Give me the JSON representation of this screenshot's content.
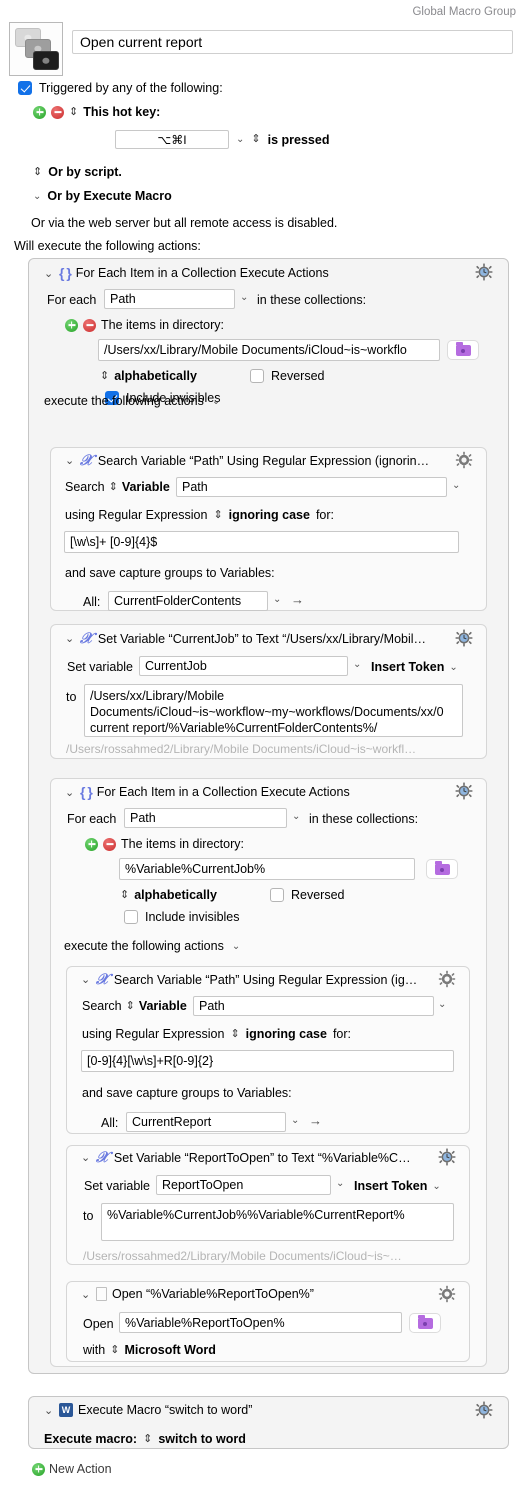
{
  "window": {
    "group_label": "Global Macro Group",
    "macro_name": "Open current report",
    "macro_icon": "stacked-keys-icon"
  },
  "trigger": {
    "checkbox_label": "Triggered by any of the following:",
    "checked": true,
    "hotkey_label": "This hot key:",
    "hotkey_value": "⌥⌘I",
    "hotkey_condition": "is pressed",
    "or_by_script": "Or by script.",
    "or_by_execute_macro": "Or by Execute Macro",
    "web_server_note": "Or via the web server but all remote access is disabled."
  },
  "actions_heading": "Will execute the following actions:",
  "new_action_label": "New Action",
  "actions": {
    "foreach_outer": {
      "title": "For Each Item in a Collection Execute Actions",
      "icon": "braces-icon",
      "gear": "gear-clock-icon",
      "for_each_label": "For each",
      "for_each_value": "Path",
      "in_collections_label": "in these collections:",
      "items_in_directory_label": "The items in directory:",
      "directory_value": "/Users/xx/Library/Mobile Documents/iCloud~is~workflo",
      "sort_value": "alphabetically",
      "reversed_label": "Reversed",
      "reversed_checked": false,
      "include_invisibles_label": "Include invisibles",
      "include_invisibles_checked": true,
      "execute_following_label": "execute the following actions"
    },
    "search1": {
      "title": "Search Variable “Path” Using Regular Expression (ignorin…",
      "icon": "variable-x-icon",
      "gear": "gear-icon",
      "search_label": "Search",
      "source_type": "Variable",
      "source_value": "Path",
      "using_label": "using Regular Expression",
      "case_option": "ignoring case",
      "for_label": "for:",
      "regex_value": "[\\w\\s]+ [0-9]{4}$",
      "capture_label": "and save capture groups to Variables:",
      "all_label": "All:",
      "all_value": "CurrentFolderContents"
    },
    "setvar1": {
      "title": "Set Variable “CurrentJob” to Text “/Users/xx/Library/Mobil…",
      "icon": "variable-x-icon",
      "gear": "gear-clock-icon",
      "set_variable_label": "Set variable",
      "variable_name": "CurrentJob",
      "insert_token_label": "Insert Token",
      "to_label": "to",
      "text_value": "/Users/xx/Library/Mobile Documents/iCloud~is~workflow~my~workflows/Documents/xx/0 current report/%Variable%CurrentFolderContents%/",
      "preview": "/Users/rossahmed2/Library/Mobile Documents/iCloud~is~workfl…"
    },
    "foreach_inner": {
      "title": "For Each Item in a Collection Execute Actions",
      "icon": "braces-icon",
      "gear": "gear-clock-icon",
      "for_each_label": "For each",
      "for_each_value": "Path",
      "in_collections_label": "in these collections:",
      "items_in_directory_label": "The items in directory:",
      "directory_value": "%Variable%CurrentJob%",
      "sort_value": "alphabetically",
      "reversed_label": "Reversed",
      "reversed_checked": false,
      "include_invisibles_label": "Include invisibles",
      "include_invisibles_checked": false,
      "execute_following_label": "execute the following actions"
    },
    "search2": {
      "title": "Search Variable “Path” Using Regular Expression (ig…",
      "icon": "variable-x-icon",
      "gear": "gear-icon",
      "search_label": "Search",
      "source_type": "Variable",
      "source_value": "Path",
      "using_label": "using Regular Expression",
      "case_option": "ignoring case",
      "for_label": "for:",
      "regex_value": "[0-9]{4}[\\w\\s]+R[0-9]{2}",
      "capture_label": "and save capture groups to Variables:",
      "all_label": "All:",
      "all_value": "CurrentReport"
    },
    "setvar2": {
      "title": "Set Variable “ReportToOpen” to Text “%Variable%C…",
      "icon": "variable-x-icon",
      "gear": "gear-clock-icon",
      "set_variable_label": "Set variable",
      "variable_name": "ReportToOpen",
      "insert_token_label": "Insert Token",
      "to_label": "to",
      "text_value": "%Variable%CurrentJob%%Variable%CurrentReport%",
      "preview": "/Users/rossahmed2/Library/Mobile Documents/iCloud~is~…"
    },
    "open": {
      "title": "Open “%Variable%ReportToOpen%”",
      "icon": "document-icon",
      "gear": "gear-icon",
      "open_label": "Open",
      "open_value": "%Variable%ReportToOpen%",
      "with_label": "with",
      "app_value": "Microsoft Word"
    },
    "execute_macro": {
      "title": "Execute Macro “switch to word”",
      "icon": "microsoft-word-icon",
      "gear": "gear-clock-icon",
      "execute_label": "Execute macro:",
      "macro_value": "switch to word"
    }
  }
}
